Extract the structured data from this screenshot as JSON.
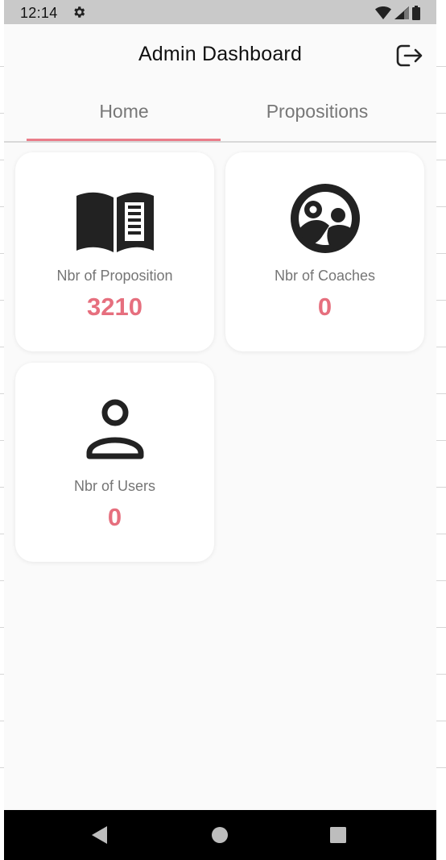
{
  "status_bar": {
    "time": "12:14",
    "icons": [
      "gear-icon",
      "wifi-icon",
      "signal-icon",
      "battery-icon"
    ]
  },
  "header": {
    "title": "Admin Dashboard",
    "logout_icon": "logout-icon"
  },
  "tabs": [
    {
      "label": "Home",
      "selected": true
    },
    {
      "label": "Propositions",
      "selected": false
    }
  ],
  "cards": [
    {
      "icon": "book-icon",
      "label": "Nbr of Proposition",
      "value": "3210"
    },
    {
      "icon": "coach-icon",
      "label": "Nbr of Coaches",
      "value": "0"
    },
    {
      "icon": "user-icon",
      "label": "Nbr of Users",
      "value": "0"
    }
  ],
  "nav_bar": {
    "buttons": [
      "back-icon",
      "home-icon",
      "recents-icon"
    ]
  },
  "colors": {
    "accent": "#e66f7e",
    "tab_indicator": "#ea7d8a",
    "background": "#fafafa",
    "card": "#ffffff"
  }
}
